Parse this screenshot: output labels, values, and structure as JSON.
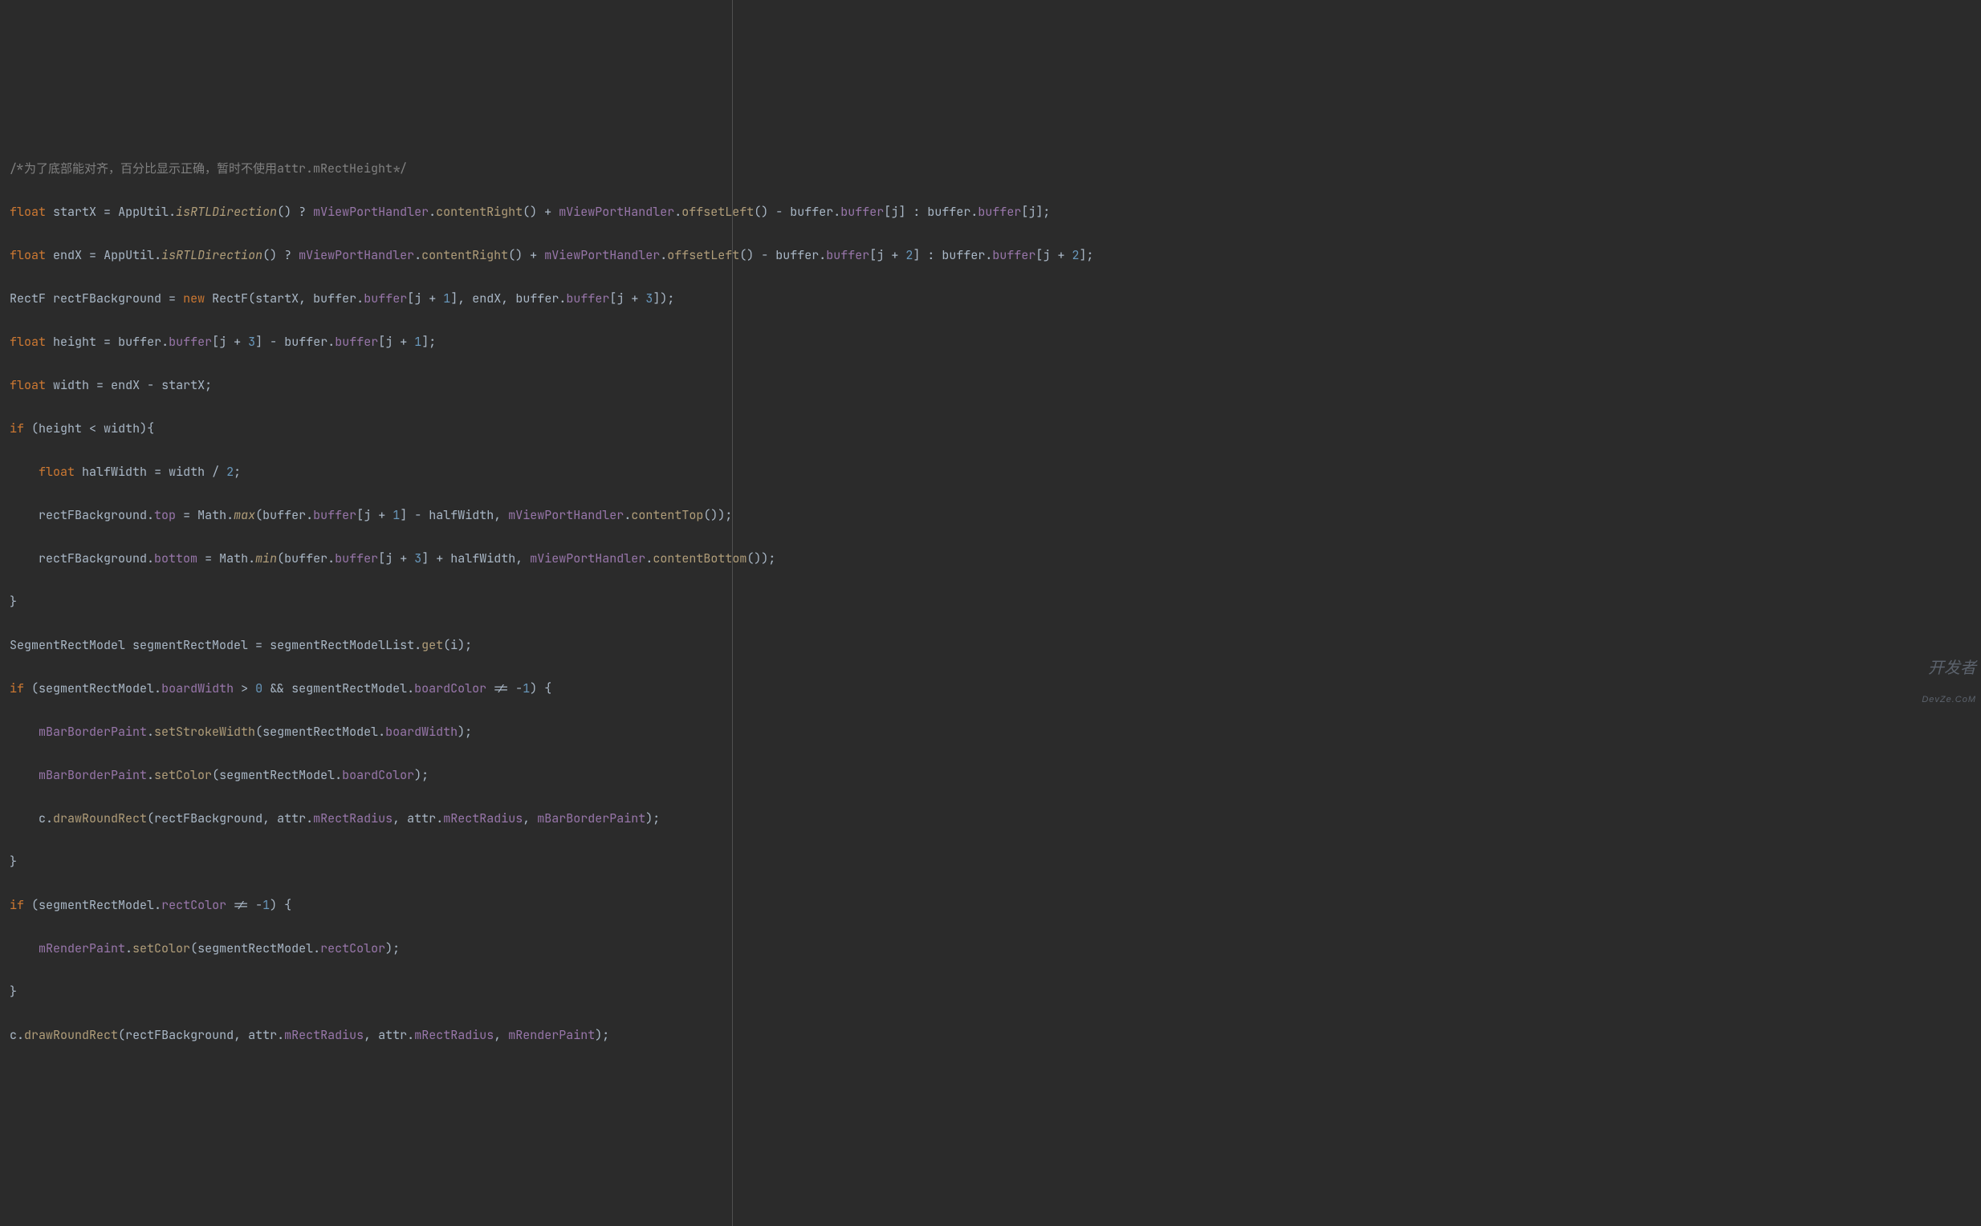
{
  "watermark": {
    "line1": "开发者",
    "line2": "DevZe.CoM"
  },
  "code": {
    "l1": {
      "comment": "/*为了底部能对齐，百分比显示正确，暂时不使用attr.mRectHeight*/"
    },
    "l2": {
      "kw": "float",
      "ident": "startX",
      "cls": "AppUtil",
      "m1": "isRTLDirection",
      "f1": "mViewPortHandler",
      "m2": "contentRight",
      "m3": "offsetLeft",
      "f2": "buffer",
      "f3": "buffer",
      "idx": "j"
    },
    "l3": {
      "kw": "float",
      "ident": "endX",
      "cls": "AppUtil",
      "m1": "isRTLDirection",
      "f1": "mViewPortHandler",
      "m2": "contentRight",
      "m3": "offsetLeft",
      "f2": "buffer",
      "f3": "buffer",
      "idx": "j",
      "off": "2"
    },
    "l4": {
      "type": "RectF",
      "ident": "rectFBackground",
      "kw": "new",
      "ctor": "RectF",
      "a1": "startX",
      "f2": "buffer",
      "f3": "buffer",
      "idx": "j",
      "off1": "1",
      "a3": "endX",
      "off2": "3"
    },
    "l5": {
      "kw": "float",
      "ident": "height",
      "f2": "buffer",
      "f3": "buffer",
      "idx": "j",
      "off1": "3",
      "off2": "1"
    },
    "l6": {
      "kw": "float",
      "ident": "width",
      "a": "endX",
      "b": "startX"
    },
    "l7": {
      "kw": "if",
      "a": "height",
      "b": "width"
    },
    "l8": {
      "kw": "float",
      "ident": "halfWidth",
      "a": "width",
      "n": "2"
    },
    "l9": {
      "obj": "rectFBackground",
      "fld": "top",
      "cls": "Math",
      "m": "max",
      "f2": "buffer",
      "f3": "buffer",
      "idx": "j",
      "off": "1",
      "hw": "halfWidth",
      "vp": "mViewPortHandler",
      "mc": "contentTop"
    },
    "l10": {
      "obj": "rectFBackground",
      "fld": "bottom",
      "cls": "Math",
      "m": "min",
      "f2": "buffer",
      "f3": "buffer",
      "idx": "j",
      "off": "3",
      "hw": "halfWidth",
      "vp": "mViewPortHandler",
      "mc": "contentBottom"
    },
    "l11": {
      "brace": "}"
    },
    "l12": {
      "type": "SegmentRectModel",
      "ident": "segmentRectModel",
      "lst": "segmentRectModelList",
      "m": "get",
      "arg": "i"
    },
    "l13": {
      "kw": "if",
      "obj": "segmentRectModel",
      "f1": "boardWidth",
      "n0": "0",
      "f2": "boardColor",
      "n1": "1"
    },
    "l14": {
      "obj": "mBarBorderPaint",
      "m": "setStrokeWidth",
      "arg": "segmentRectModel",
      "fld": "boardWidth"
    },
    "l15": {
      "obj": "mBarBorderPaint",
      "m": "setColor",
      "arg": "segmentRectModel",
      "fld": "boardColor"
    },
    "l16": {
      "obj": "c",
      "m": "drawRoundRect",
      "a1": "rectFBackground",
      "attr": "attr",
      "fr": "mRectRadius",
      "pnt": "mBarBorderPaint"
    },
    "l17": {
      "brace": "}"
    },
    "l18": {
      "kw": "if",
      "obj": "segmentRectModel",
      "f1": "rectColor",
      "n1": "1"
    },
    "l19": {
      "obj": "mRenderPaint",
      "m": "setColor",
      "arg": "segmentRectModel",
      "fld": "rectColor"
    },
    "l20": {
      "brace": "}"
    },
    "l21": {
      "obj": "c",
      "m": "drawRoundRect",
      "a1": "rectFBackground",
      "attr": "attr",
      "fr": "mRectRadius",
      "pnt": "mRenderPaint"
    }
  }
}
